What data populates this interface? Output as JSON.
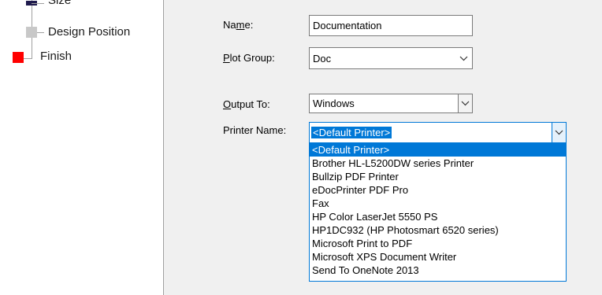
{
  "steps": [
    {
      "label": "Size",
      "state": "done"
    },
    {
      "label": "Design Position",
      "state": "pending"
    },
    {
      "label": "Finish",
      "state": "current"
    }
  ],
  "colors": {
    "done": "#1f1a4d",
    "pending": "#c8c8c8",
    "current": "#ff0000",
    "accent": "#0078d7"
  },
  "form": {
    "name": {
      "label_pre": "Na",
      "label_ul": "m",
      "label_post": "e:",
      "value": "Documentation"
    },
    "plot_group": {
      "label_pre": "",
      "label_ul": "P",
      "label_post": "lot Group:",
      "value": "Doc"
    },
    "output_to": {
      "label_pre": "",
      "label_ul": "O",
      "label_post": "utput To:",
      "value": "Windows"
    },
    "printer_name": {
      "label": "Printer Name:",
      "value": "<Default Printer>"
    }
  },
  "printer_options": [
    "<Default Printer>",
    "Brother HL-L5200DW series Printer",
    "Bullzip PDF Printer",
    "eDocPrinter PDF Pro",
    "Fax",
    "HP Color LaserJet 5550 PS",
    "HP1DC932 (HP Photosmart 6520 series)",
    "Microsoft Print to PDF",
    "Microsoft XPS Document Writer",
    "Send To OneNote 2013"
  ],
  "icons": {
    "chevron": "chevron-down-icon"
  }
}
